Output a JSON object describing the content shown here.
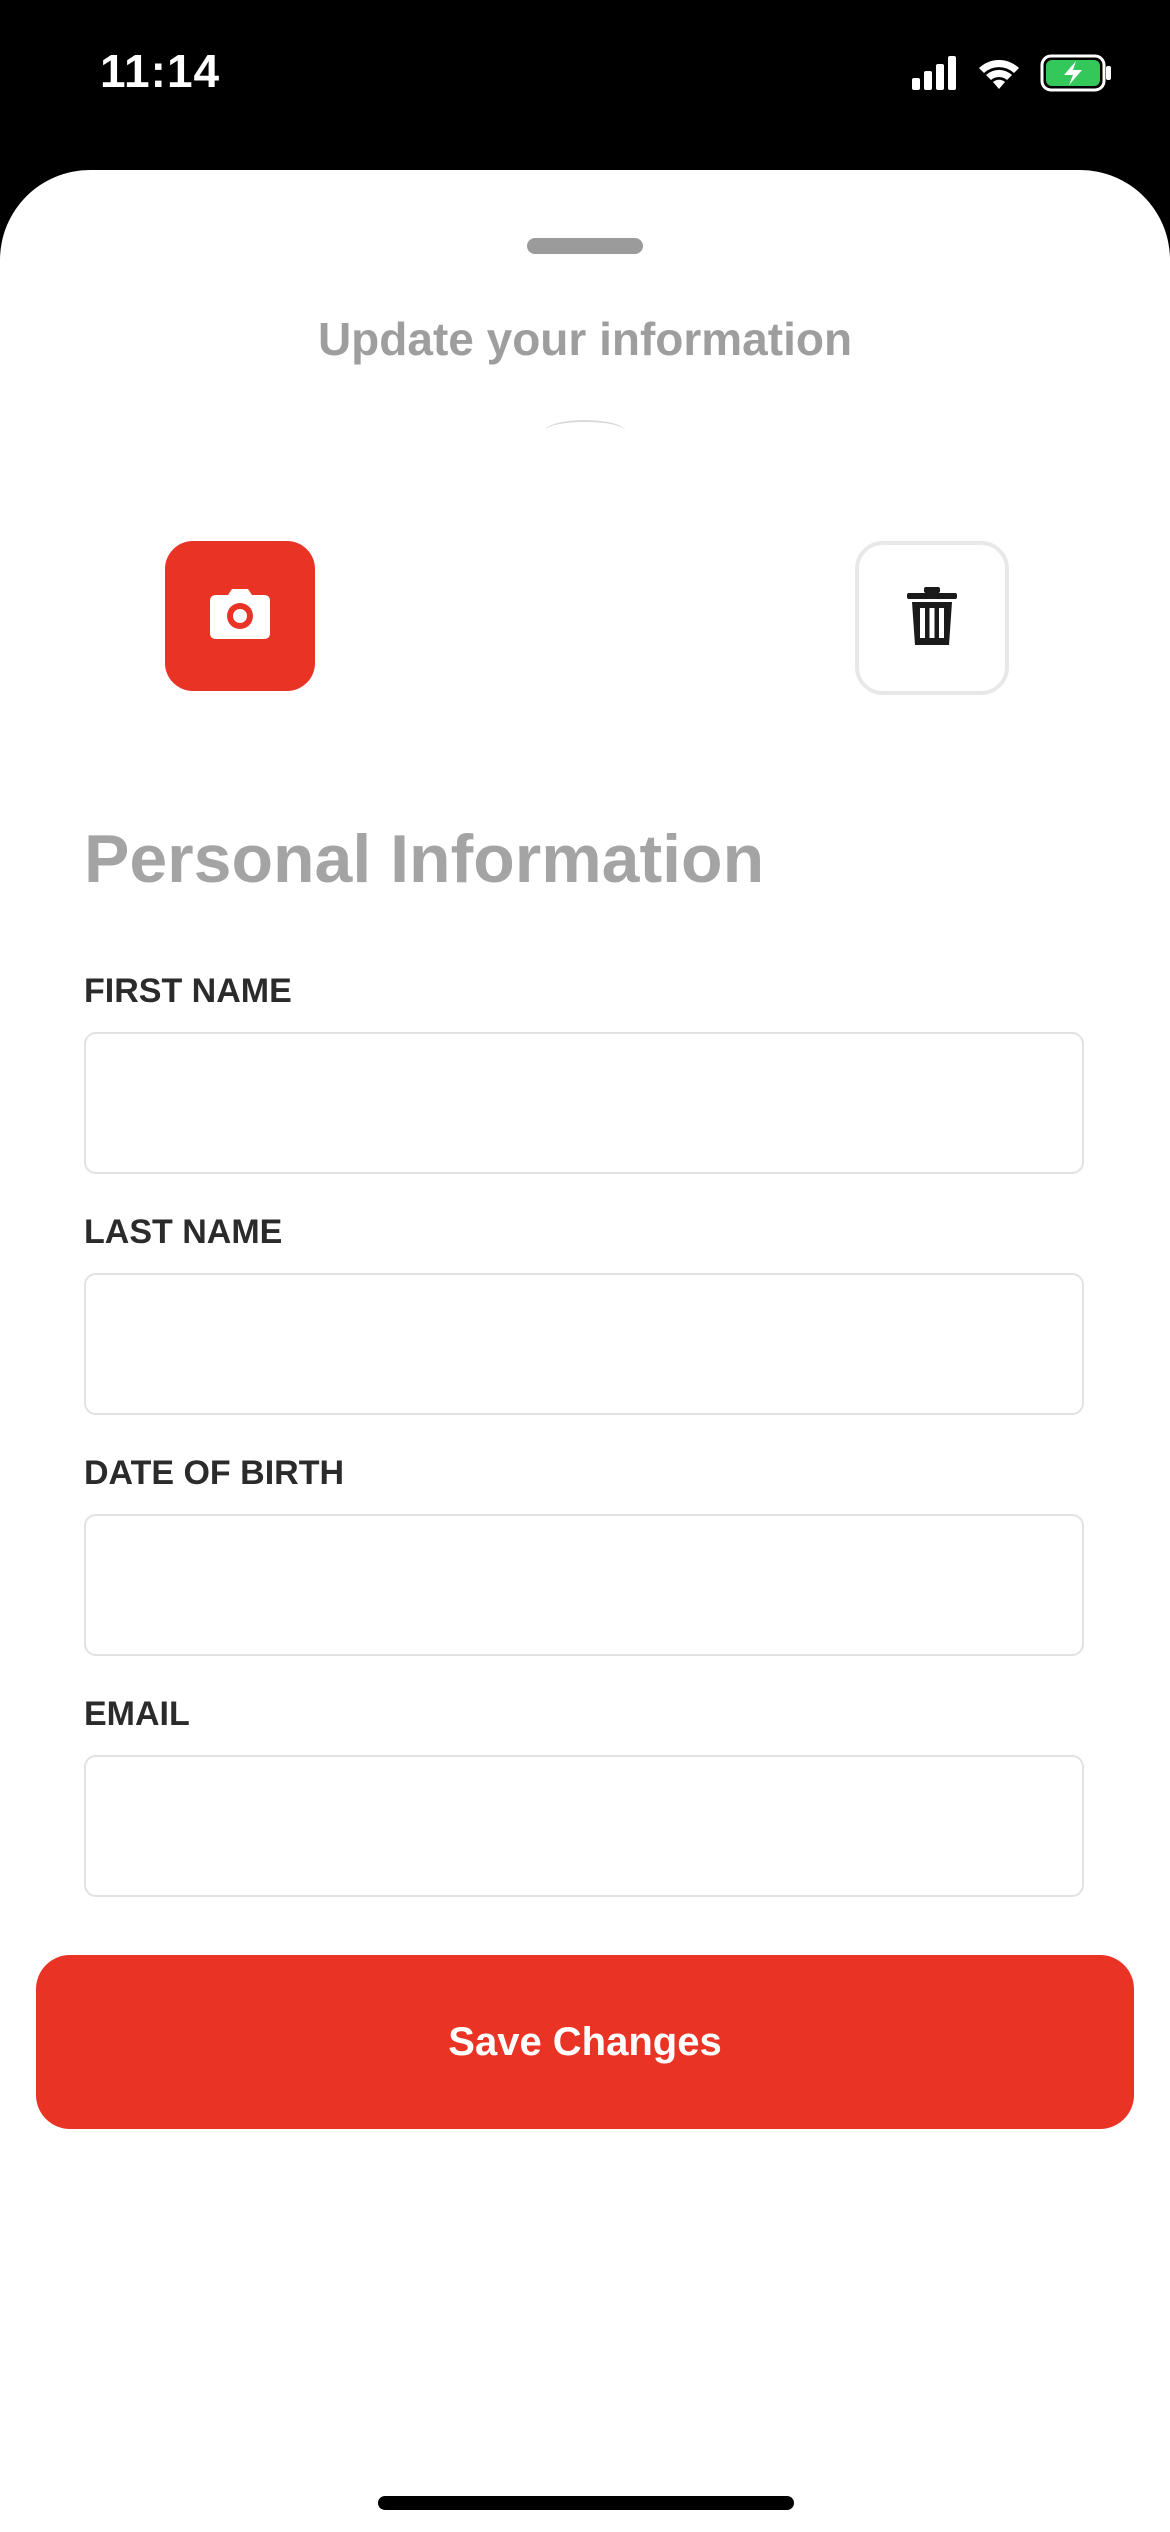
{
  "status_bar": {
    "time": "11:14",
    "icons": [
      "cellular-signal-icon",
      "wifi-icon",
      "battery-charging-icon"
    ],
    "battery_color": "#34c759"
  },
  "sheet": {
    "title": "Update your information"
  },
  "photo_actions": {
    "camera_icon": "camera-icon",
    "delete_icon": "trash-icon",
    "accent_color": "#e93324"
  },
  "form": {
    "section_title": "Personal Information",
    "fields": [
      {
        "label": "FIRST NAME",
        "value": ""
      },
      {
        "label": "LAST NAME",
        "value": ""
      },
      {
        "label": "DATE OF BIRTH",
        "value": ""
      },
      {
        "label": "EMAIL",
        "value": ""
      }
    ]
  },
  "actions": {
    "save_label": "Save Changes"
  }
}
